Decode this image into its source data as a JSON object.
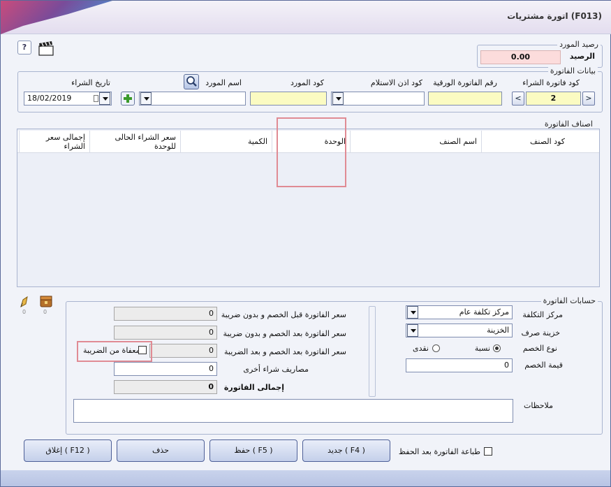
{
  "window": {
    "title": "اتورة مشتريات  (F013)"
  },
  "supplier_balance": {
    "group_title": "رصيد المورد",
    "label": "الرصيد",
    "value": "0.00"
  },
  "invoice_data": {
    "group_title": "بيانات الفاتورة",
    "purchase_invoice_code_label": "كود فاتورة الشراء",
    "purchase_invoice_code_value": "2",
    "paper_invoice_number_label": "رقم الفاتورة الورقية",
    "receipt_permit_code_label": "كود اذن الاستلام",
    "supplier_code_label": "كود المورد",
    "supplier_name_label": "اسم المورد",
    "purchase_date_label": "تاريخ الشراء",
    "purchase_date_value": "18/02/2019",
    "prev_label": "<",
    "next_label": ">"
  },
  "items": {
    "group_title": "اصناف الفاتورة",
    "columns": [
      "كود الصنف",
      "اسم الصنف",
      "الوحدة",
      "الكمية",
      "سعر الشراء الحالى للوحدة",
      "إجمالى سعر الشراء"
    ]
  },
  "accounts": {
    "group_title": "حسابات الفاتورة",
    "cost_center_label": "مركز التكلفة",
    "cost_center_value": "مركز تكلفة عام",
    "treasury_label": "خزينة صرف",
    "treasury_value": "الخزينة",
    "discount_type_label": "نوع الخصم",
    "discount_percent_label": "نسبة",
    "discount_cash_label": "نقدى",
    "discount_value_label": "قيمة الخصم",
    "discount_value": "0",
    "before_discount_label": "سعر الفاتورة قبل الخصم و بدون ضريبة",
    "before_discount_value": "0",
    "after_discount_label": "سعر الفاتورة بعد الخصم و بدون ضريبة",
    "after_discount_value": "0",
    "after_discount_tax_label": "سعر الفاتورة بعد الخصم و بعد الضريبة",
    "after_discount_tax_value": "0",
    "tax_exempt_label": "معفاة من الضريبة",
    "other_expenses_label": "مصاريف شراء أخرى",
    "other_expenses_value": "0",
    "total_label": "إجمالى الفاتورة",
    "total_value": "0",
    "notes_label": "ملاحظات",
    "icon_counts": [
      "0",
      "0"
    ]
  },
  "footer": {
    "print_after_save_label": "طباعة الفاتورة بعد الحفظ",
    "new_label": "جديد ( F4 )",
    "save_label": "حفظ ( F5 )",
    "delete_label": "حذف",
    "close_label": "إغلاق ( F12 )"
  },
  "colors": {
    "annotation_highlight": "#e08b94",
    "yellow_field": "#fbfbc2",
    "balance_field": "#fcdcdc"
  }
}
